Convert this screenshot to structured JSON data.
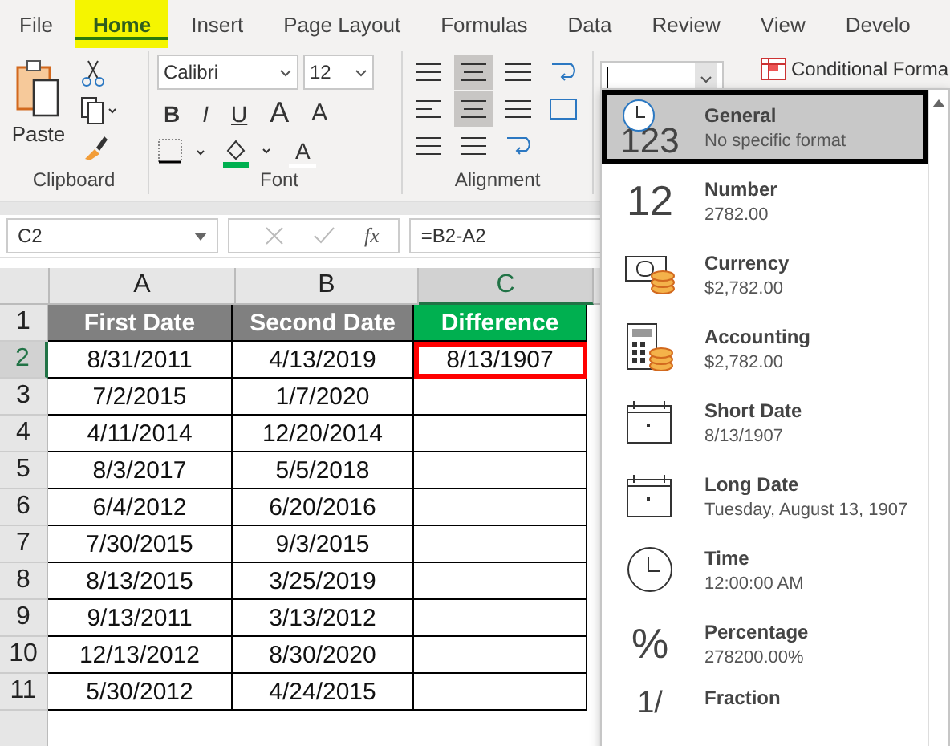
{
  "tabs": [
    {
      "label": "File",
      "selected": false
    },
    {
      "label": "Home",
      "selected": true
    },
    {
      "label": "Insert",
      "selected": false
    },
    {
      "label": "Page Layout",
      "selected": false
    },
    {
      "label": "Formulas",
      "selected": false
    },
    {
      "label": "Data",
      "selected": false
    },
    {
      "label": "Review",
      "selected": false
    },
    {
      "label": "View",
      "selected": false
    },
    {
      "label": "Develo",
      "selected": false
    }
  ],
  "ribbon": {
    "clipboard": {
      "label": "Clipboard",
      "paste": "Paste"
    },
    "font": {
      "label": "Font",
      "font_name": "Calibri",
      "font_size": "12",
      "style_buttons": [
        "B",
        "I",
        "U"
      ],
      "grow": "A",
      "shrink": "A",
      "font_color": "A"
    },
    "alignment": {
      "label": "Alignment",
      "buttons": [
        {
          "selected": false
        },
        {
          "selected": true
        },
        {
          "selected": false
        },
        {
          "selected": false
        },
        {
          "selected": false
        },
        {
          "selected": true
        },
        {
          "selected": false
        },
        {
          "selected": false
        },
        {
          "selected": false
        },
        {
          "selected": false
        },
        {
          "selected": false
        }
      ]
    },
    "conditional_formatting": "Conditional Forma"
  },
  "formula_bar": {
    "name_box": "C2",
    "fx": "fx",
    "formula": "=B2-A2"
  },
  "sheet": {
    "columns": [
      {
        "label": "A",
        "selected": false
      },
      {
        "label": "B",
        "selected": false
      },
      {
        "label": "C",
        "selected": true
      }
    ],
    "header_row": {
      "number": "1",
      "cells": [
        {
          "text": "First Date",
          "color": "#808080"
        },
        {
          "text": "Second Date",
          "color": "#808080"
        },
        {
          "text": "Difference",
          "color": "#00b050"
        }
      ]
    },
    "rows": [
      {
        "number": "2",
        "selected": true,
        "cells": [
          "8/31/2011",
          "4/13/2019",
          "8/13/1907"
        ]
      },
      {
        "number": "3",
        "selected": false,
        "cells": [
          "7/2/2015",
          "1/7/2020"
        ]
      },
      {
        "number": "4",
        "selected": false,
        "cells": [
          "4/11/2014",
          "12/20/2014"
        ]
      },
      {
        "number": "5",
        "selected": false,
        "cells": [
          "8/3/2017",
          "5/5/2018"
        ]
      },
      {
        "number": "6",
        "selected": false,
        "cells": [
          "6/4/2012",
          "6/20/2016"
        ]
      },
      {
        "number": "7",
        "selected": false,
        "cells": [
          "7/30/2015",
          "9/3/2015"
        ]
      },
      {
        "number": "8",
        "selected": false,
        "cells": [
          "8/13/2015",
          "3/25/2019"
        ]
      },
      {
        "number": "9",
        "selected": false,
        "cells": [
          "9/13/2011",
          "3/13/2012"
        ]
      },
      {
        "number": "10",
        "selected": false,
        "cells": [
          "12/13/2012",
          "8/30/2020"
        ]
      },
      {
        "number": "11",
        "selected": false,
        "cells": [
          "5/30/2012",
          "4/24/2015"
        ]
      }
    ]
  },
  "format_menu": [
    {
      "kind": "clock-number",
      "icon_text": "123",
      "name": "General",
      "example": "No specific format",
      "selected": true
    },
    {
      "kind": "text",
      "icon_text": "12",
      "name": "Number",
      "example": "2782.00",
      "selected": false
    },
    {
      "kind": "currency",
      "name": "Currency",
      "example": "$2,782.00",
      "selected": false
    },
    {
      "kind": "accounting",
      "name": "Accounting",
      "example": "$2,782.00",
      "selected": false
    },
    {
      "kind": "calendar",
      "name": "Short Date",
      "example": "8/13/1907",
      "selected": false
    },
    {
      "kind": "calendar",
      "name": "Long Date",
      "example": "Tuesday, August 13, 1907",
      "selected": false
    },
    {
      "kind": "clock",
      "name": "Time",
      "example": "12:00:00 AM",
      "selected": false
    },
    {
      "kind": "text",
      "icon_text": "%",
      "name": "Percentage",
      "example": "278200.00%",
      "selected": false
    },
    {
      "kind": "text",
      "icon_text": "1/",
      "name": "Fraction",
      "selected": false
    }
  ]
}
